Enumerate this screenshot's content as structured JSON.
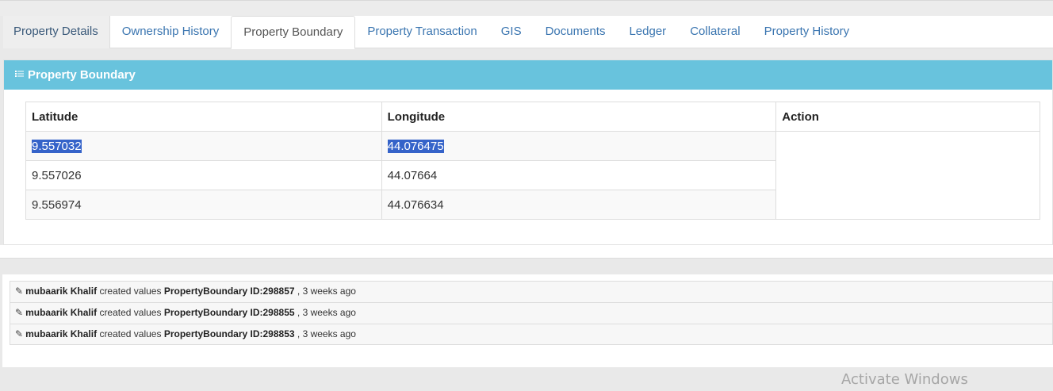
{
  "tabs": [
    {
      "label": "Property Details"
    },
    {
      "label": "Ownership History"
    },
    {
      "label": "Property Boundary"
    },
    {
      "label": "Property Transaction"
    },
    {
      "label": "GIS"
    },
    {
      "label": "Documents"
    },
    {
      "label": "Ledger"
    },
    {
      "label": "Collateral"
    },
    {
      "label": "Property History"
    }
  ],
  "panel": {
    "icon": "list-icon",
    "title": "Property Boundary"
  },
  "table": {
    "headers": {
      "latitude": "Latitude",
      "longitude": "Longitude",
      "action": "Action"
    },
    "rows": [
      {
        "latitude": "9.557032",
        "longitude": "44.076475"
      },
      {
        "latitude": "9.557026",
        "longitude": "44.07664"
      },
      {
        "latitude": "9.556974",
        "longitude": "44.076634"
      }
    ]
  },
  "log": [
    {
      "user": "mubaarik Khalif",
      "action": "created values",
      "entity": "PropertyBoundary ID:298857",
      "time": ", 3 weeks ago"
    },
    {
      "user": "mubaarik Khalif",
      "action": "created values",
      "entity": "PropertyBoundary ID:298855",
      "time": ", 3 weeks ago"
    },
    {
      "user": "mubaarik Khalif",
      "action": "created values",
      "entity": "PropertyBoundary ID:298853",
      "time": ", 3 weeks ago"
    }
  ],
  "watermark": "Activate Windows",
  "colors": {
    "panel_header": "#68c3dd",
    "selection": "#3563c9",
    "tab_link": "#3a75b0"
  }
}
